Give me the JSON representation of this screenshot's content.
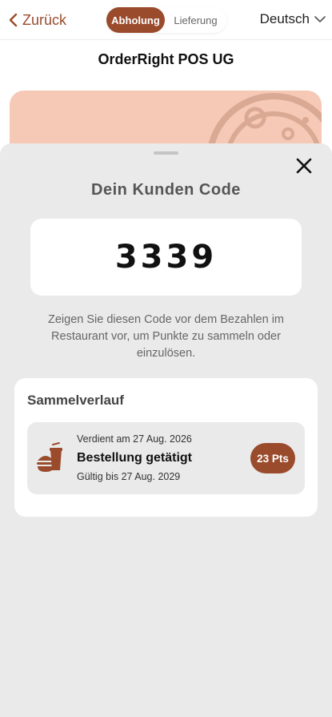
{
  "header": {
    "back_label": "Zurück",
    "mode_pickup": "Abholung",
    "mode_delivery": "Lieferung",
    "language": "Deutsch"
  },
  "store": {
    "name": "OrderRight POS UG"
  },
  "sheet": {
    "title": "Dein Kunden Code",
    "code": "3339",
    "hint": "Zeigen Sie diesen Code vor dem Bezahlen im Restaurant vor, um Punkte zu sammeln oder einzulösen."
  },
  "history": {
    "title": "Sammelverlauf",
    "entries": [
      {
        "earned": "Verdient am 27 Aug. 2026",
        "title": "Bestellung getätigt",
        "valid": "Gültig bis 27 Aug. 2029",
        "points": "23 Pts",
        "icon": "burger-drink-icon"
      }
    ]
  },
  "colors": {
    "accent": "#9a4b2c",
    "banner": "#f5c9b6",
    "sheet_bg": "#eaeaea"
  }
}
